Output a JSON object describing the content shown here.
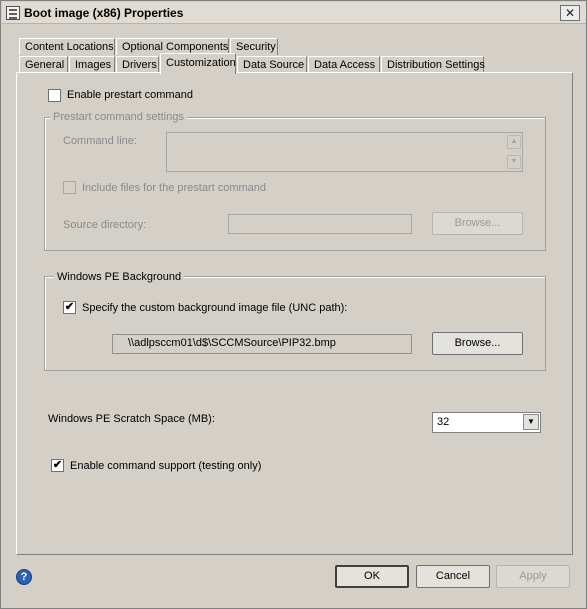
{
  "window": {
    "title": "Boot image (x86) Properties",
    "close_glyph": "✕"
  },
  "tabs": {
    "row1": [
      {
        "label": "Content Locations"
      },
      {
        "label": "Optional Components"
      },
      {
        "label": "Security"
      }
    ],
    "row2": [
      {
        "label": "General"
      },
      {
        "label": "Images"
      },
      {
        "label": "Drivers"
      },
      {
        "label": "Customization",
        "active": true
      },
      {
        "label": "Data Source"
      },
      {
        "label": "Data Access"
      },
      {
        "label": "Distribution Settings"
      }
    ]
  },
  "prestart": {
    "enable_label": "Enable prestart command",
    "enable_checked": false,
    "group_title": "Prestart command settings",
    "command_line_label": "Command line:",
    "command_line_value": "",
    "include_files_label": "Include files for the prestart command",
    "include_files_checked": false,
    "source_directory_label": "Source directory:",
    "source_directory_value": "",
    "browse_label": "Browse..."
  },
  "background": {
    "group_title": "Windows PE Background",
    "specify_label": "Specify the custom background image file (UNC path):",
    "specify_checked": true,
    "path_value": "\\\\adlpsccm01\\d$\\SCCMSource\\PIP32.bmp",
    "browse_label": "Browse..."
  },
  "scratch": {
    "label": "Windows PE Scratch Space (MB):",
    "selected_value": "32"
  },
  "command_support": {
    "label": "Enable command support (testing only)",
    "checked": true
  },
  "footer": {
    "ok_label": "OK",
    "cancel_label": "Cancel",
    "apply_label": "Apply",
    "help_glyph": "?"
  },
  "glyphs": {
    "check": "✔",
    "scroll_up": "▲",
    "scroll_down": "▼",
    "dropdown": "▼"
  },
  "icons": {
    "title": "properties-window-icon",
    "help": "help-icon",
    "close": "close-icon"
  },
  "colors": {
    "dialog_bg": "#d4d0c8",
    "help_blue": "#2b5fb8"
  }
}
